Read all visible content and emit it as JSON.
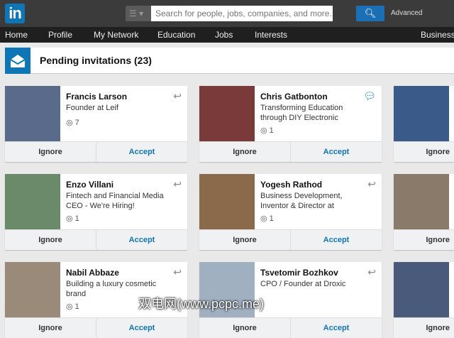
{
  "header": {
    "logo": "in",
    "search_placeholder": "Search for people, jobs, companies, and more...",
    "advanced": "Advanced"
  },
  "nav": [
    "Home",
    "Profile",
    "My Network",
    "Education",
    "Jobs",
    "Interests",
    "Business"
  ],
  "page": {
    "title": "Pending invitations (23)"
  },
  "buttons": {
    "ignore": "Ignore",
    "accept": "Accept"
  },
  "cards": [
    {
      "name": "Francis Larson",
      "headline": "Founder at Leif",
      "connections": "7",
      "action": "reply",
      "photo": "#5a6a8a"
    },
    {
      "name": "Chris Gatbonton",
      "headline": "Transforming Education through DIY Electronic",
      "connections": "1",
      "action": "message",
      "photo": "#7a3a3a"
    },
    {
      "name": "",
      "headline": "",
      "connections": "",
      "action": "",
      "photo": "#3a5a8a"
    },
    {
      "name": "Enzo Villani",
      "headline": "Fintech and Financial Media CEO - We're Hiring!",
      "connections": "1",
      "action": "reply",
      "photo": "#6a8a6a"
    },
    {
      "name": "Yogesh Rathod",
      "headline": "Business Development, Inventor & Director at",
      "connections": "1",
      "action": "reply",
      "photo": "#8a6a4a"
    },
    {
      "name": "",
      "headline": "",
      "connections": "",
      "action": "",
      "photo": "#8a7a6a"
    },
    {
      "name": "Nabil Abbaze",
      "headline": "Building a luxury cosmetic brand",
      "connections": "1",
      "action": "reply",
      "photo": "#9a8a7a"
    },
    {
      "name": "Tsvetomir Bozhkov",
      "headline": "CPO / Founder at Droxic",
      "connections": "",
      "action": "reply",
      "photo": "#a0b0c0"
    },
    {
      "name": "",
      "headline": "",
      "connections": "",
      "action": "",
      "photo": "#4a5a7a"
    }
  ],
  "watermark": "双电网(www.pcpc.me)"
}
